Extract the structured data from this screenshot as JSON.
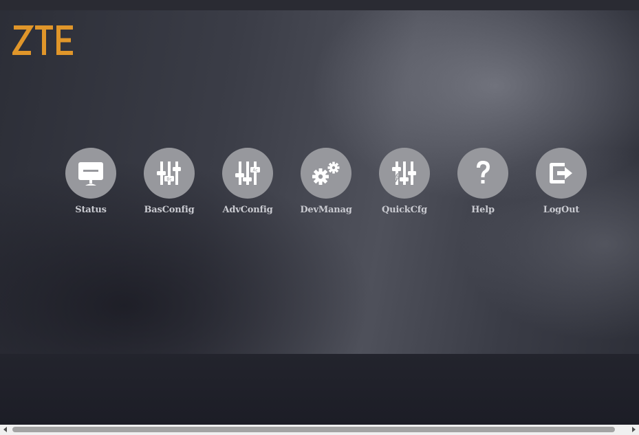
{
  "brand": {
    "logo_text": "ZTE",
    "logo_color": "#e0962a"
  },
  "menu": {
    "items": [
      {
        "label": "Status",
        "icon": "monitor-icon"
      },
      {
        "label": "BasConfig",
        "icon": "sliders-basic-icon"
      },
      {
        "label": "AdvConfig",
        "icon": "sliders-advanced-icon"
      },
      {
        "label": "DevManag",
        "icon": "gears-icon"
      },
      {
        "label": "QuickCfg",
        "icon": "sliders-quick-icon"
      },
      {
        "label": "Help",
        "icon": "question-mark-icon"
      },
      {
        "label": "LogOut",
        "icon": "logout-icon"
      }
    ]
  },
  "colors": {
    "icon_circle": "#97989d",
    "icon_glyph": "#ffffff",
    "label_text": "#c9cad0"
  }
}
